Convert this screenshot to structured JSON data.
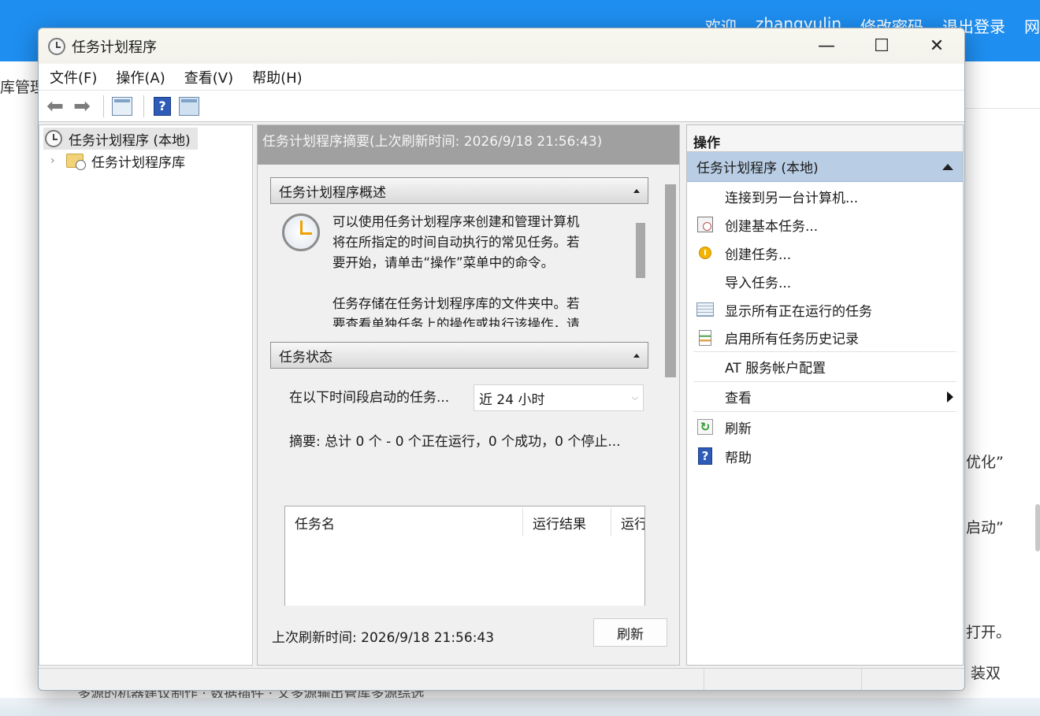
{
  "background": {
    "links": [
      "欢迎",
      "zhangyulin",
      "修改密码",
      "退出登录",
      "网"
    ],
    "left_text": "库管理",
    "right_lines": [
      "优化”",
      "启动”",
      "打开。",
      "装双"
    ],
    "bottom_text": "多源的机器建议制作 · 数据插件 · 文多源输出管库多源综选"
  },
  "window": {
    "title": "任务计划程序",
    "controls": {
      "minimize": "—",
      "maximize": "☐",
      "close": "✕"
    }
  },
  "menu": [
    "文件(F)",
    "操作(A)",
    "查看(V)",
    "帮助(H)"
  ],
  "tree": {
    "root": "任务计划程序 (本地)",
    "child": "任务计划程序库"
  },
  "center": {
    "header": "任务计划程序摘要(上次刷新时间: 2026/9/18 21:56:43)",
    "overview": {
      "title": "任务计划程序概述",
      "text_lines": [
        "可以使用任务计划程序来创建和管理计算机",
        "将在所指定的时间自动执行的常见任务。若",
        "要开始，请单击“操作”菜单中的命令。",
        "",
        "任务存储在任务计划程序库的文件夹中。若",
        "要查看单独任务上的操作或执行该操作，请"
      ]
    },
    "status": {
      "title": "任务状态",
      "period_label": "在以下时间段启动的任务...",
      "period_value": "近 24 小时",
      "summary": "摘要: 总计 0 个 - 0 个正在运行，0 个成功，0 个停止...",
      "columns": [
        "任务名",
        "运行结果",
        "运行"
      ]
    },
    "footer": {
      "last_refresh": "上次刷新时间: 2026/9/18 21:56:43",
      "refresh_button": "刷新"
    }
  },
  "actions": {
    "title": "操作",
    "group": "任务计划程序 (本地)",
    "items": [
      {
        "label": "连接到另一台计算机...",
        "icon": "none"
      },
      {
        "label": "创建基本任务...",
        "icon": "basic-task-icon"
      },
      {
        "label": "创建任务...",
        "icon": "create-task-icon"
      },
      {
        "label": "导入任务...",
        "icon": "none"
      },
      {
        "label": "显示所有正在运行的任务",
        "icon": "running-tasks-icon"
      },
      {
        "label": "启用所有任务历史记录",
        "icon": "history-icon"
      },
      {
        "label": "AT 服务帐户配置",
        "icon": "none"
      },
      {
        "label": "查看",
        "icon": "none"
      },
      {
        "label": "刷新",
        "icon": "refresh-icon"
      },
      {
        "label": "帮助",
        "icon": "help-icon"
      }
    ]
  },
  "colors": {
    "web_header": "#1e8ef0",
    "selected_group": "#b9cde4",
    "center_header": "#a0a0a0"
  }
}
